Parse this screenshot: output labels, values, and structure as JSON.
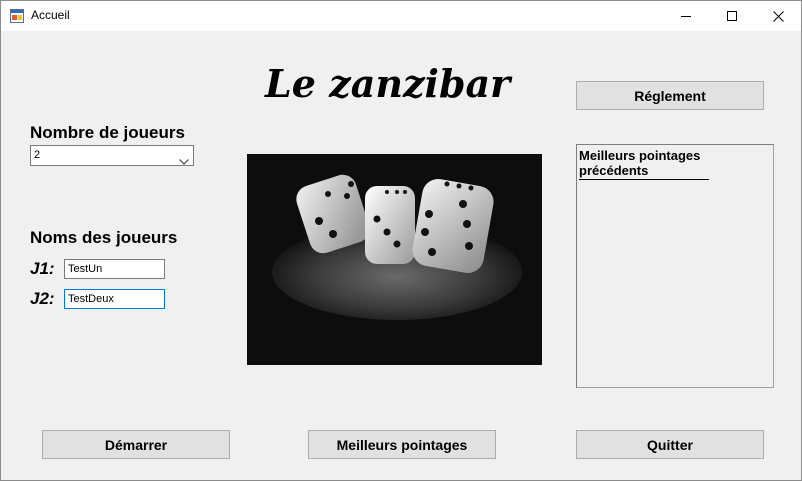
{
  "window": {
    "title": "Accueil",
    "icons": {
      "app": "app-icon",
      "minimize": "minimize-icon",
      "maximize": "maximize-icon",
      "close": "close-icon"
    }
  },
  "game_title": "Le zanzibar",
  "rules_button": "Réglement",
  "players": {
    "count_label": "Nombre de joueurs",
    "count_value": "2",
    "names_label": "Noms des joueurs",
    "list": [
      {
        "label": "J1:",
        "value": "TestUn"
      },
      {
        "label": "J2:",
        "value": "TestDeux"
      }
    ]
  },
  "image": {
    "name": "dice-image"
  },
  "scores_panel": {
    "heading": "Meilleurs pointages précédents"
  },
  "buttons": {
    "start": "Démarrer",
    "high_scores": "Meilleurs pointages",
    "quit": "Quitter"
  }
}
